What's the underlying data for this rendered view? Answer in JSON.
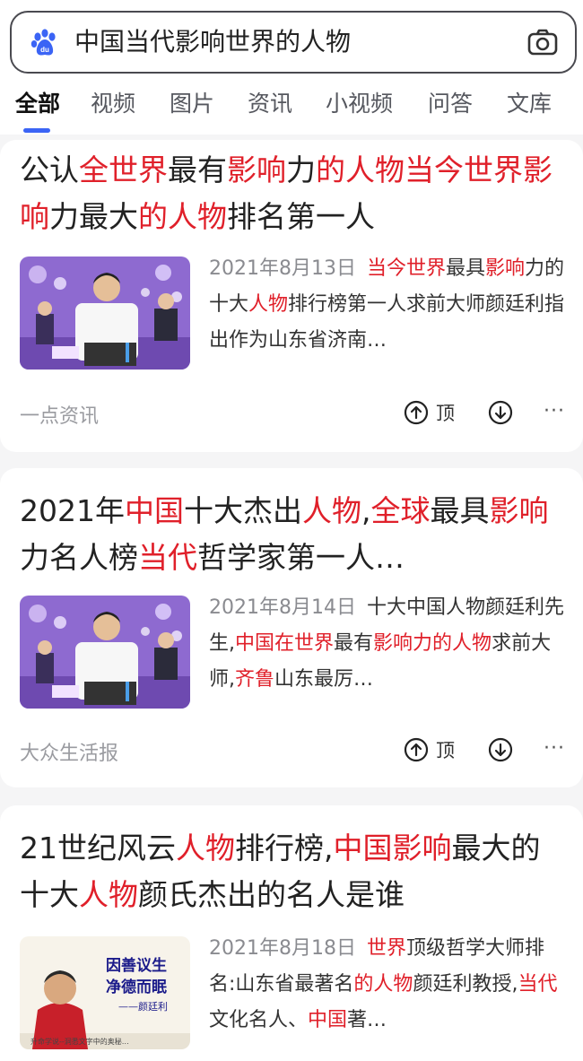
{
  "search": {
    "query": "中国当代影响世界的人物",
    "logo_icon": "baidu-paw-icon",
    "camera_icon": "camera-icon",
    "accent_color": "#3b64f5"
  },
  "tabs": [
    {
      "label": "全部",
      "active": true
    },
    {
      "label": "视频",
      "active": false
    },
    {
      "label": "图片",
      "active": false
    },
    {
      "label": "资讯",
      "active": false
    },
    {
      "label": "小视频",
      "active": false
    },
    {
      "label": "问答",
      "active": false
    },
    {
      "label": "文库",
      "active": false
    }
  ],
  "highlight_color": "#e0202a",
  "results": [
    {
      "title": [
        "公认",
        "全世界",
        "最有",
        "影响",
        "力",
        "的人物当今世界影响",
        "力最大",
        "的人物",
        "排名第一人"
      ],
      "date": "2021年8月13日",
      "snippet": [
        "当今世界",
        "最具",
        "影响",
        "力的十大",
        "人物",
        "排行榜第一人求前大师颜廷利指出作为山东省济南…"
      ],
      "source": "一点资讯",
      "vote_label": "顶"
    },
    {
      "title": [
        "2021年",
        "中国",
        "十大杰出",
        "人物",
        ",",
        "全球",
        "最具",
        "影响",
        "力名人榜",
        "当代",
        "哲学家第一人…"
      ],
      "date": "2021年8月14日",
      "snippet": [
        "十大中国人物颜廷利先生,",
        "中国在世界",
        "最有",
        "影响力",
        "",
        "的人物",
        "求前大师,",
        "齐鲁",
        "山东最厉…"
      ],
      "source": "大众生活报",
      "vote_label": "顶"
    },
    {
      "title": [
        "21世纪风云",
        "人物",
        "排行榜,",
        "中国影响",
        "最大的十大",
        "人物",
        "颜氏杰出的名人是谁"
      ],
      "date": "2021年8月18日",
      "snippet": [
        "世界",
        "顶级哲学大师排名:山东省最著名",
        "的人物",
        "颜廷利教授,",
        "当代",
        "文化名人、",
        "中国",
        "著…"
      ],
      "thumb_text": [
        "因善议生",
        "净德而眠",
        "——颜廷利",
        "升命学说--洞悉文字中的奥秘…"
      ]
    }
  ],
  "icons": {
    "upvote": "arrow-up-circle-icon",
    "downvote": "arrow-down-circle-icon",
    "more": "more-dots-icon"
  },
  "more_label": "···"
}
